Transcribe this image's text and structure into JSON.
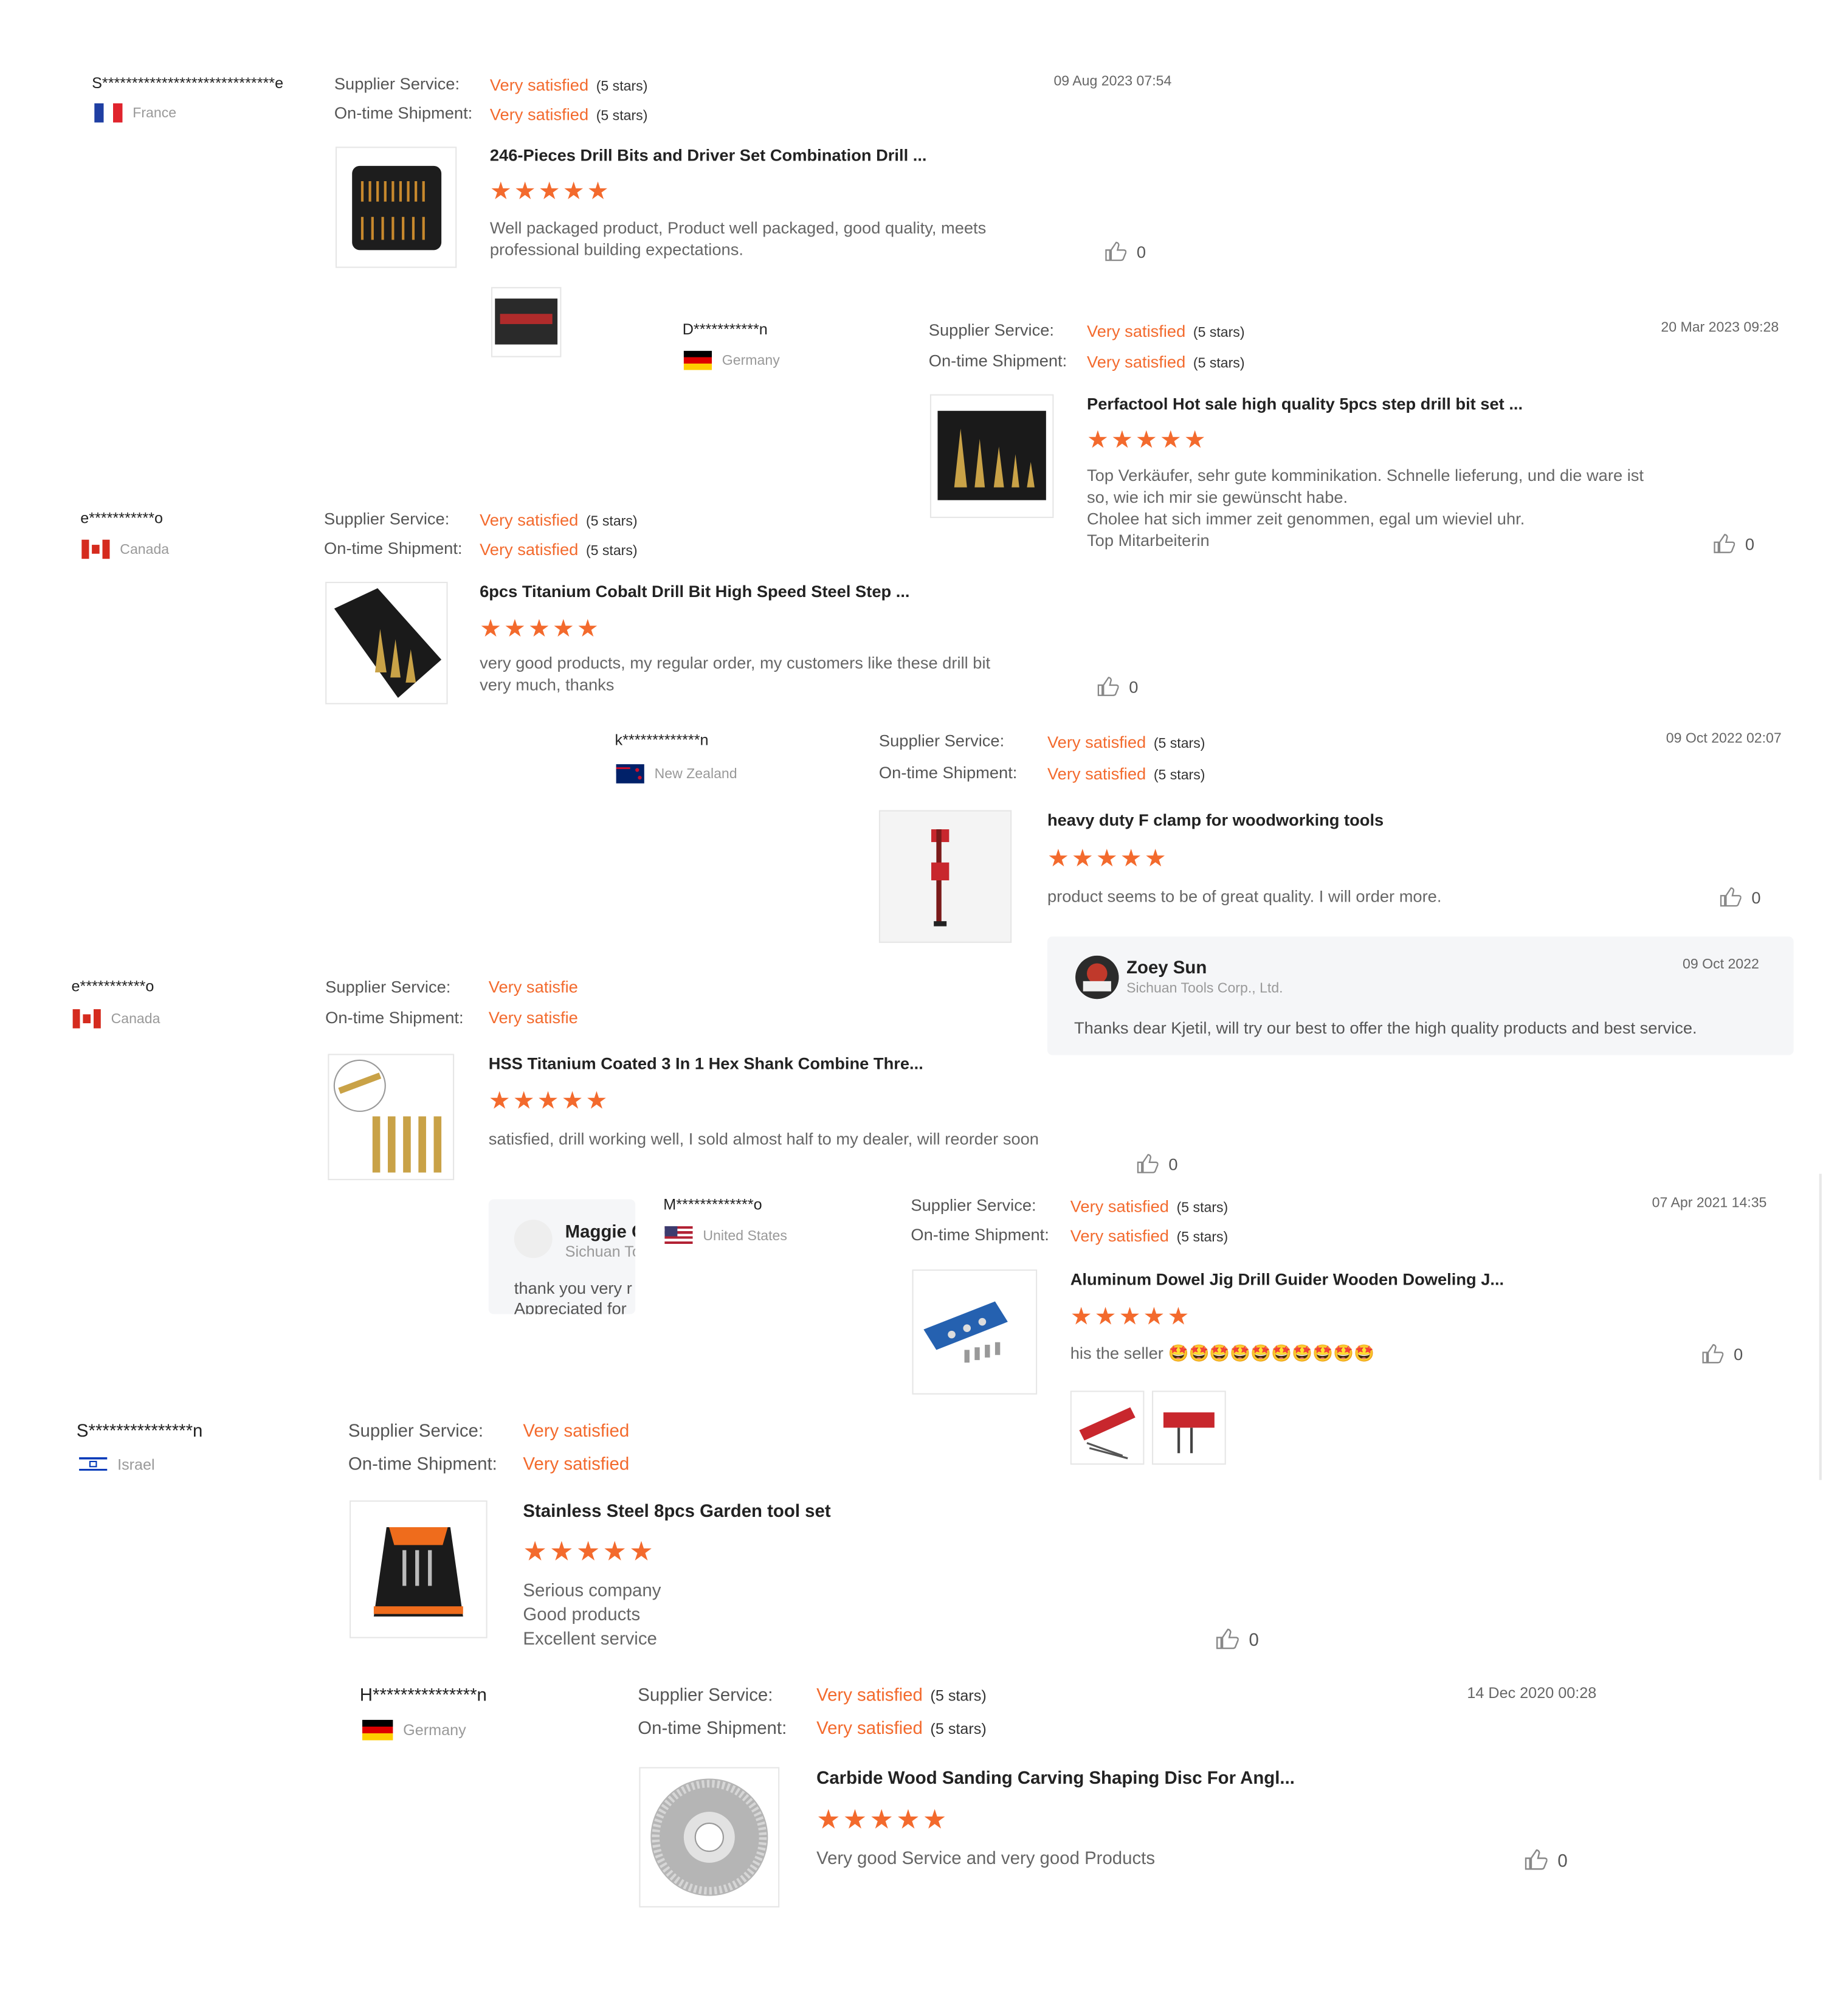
{
  "labels": {
    "supplier": "Supplier Service:",
    "shipment": "On-time Shipment:",
    "satisfied": "Very satisfied",
    "stars_note": "(5 stars)"
  },
  "reviews": [
    {
      "name": "S*****************************e",
      "country": "France",
      "date": "09 Aug 2023 07:54",
      "product": "246-Pieces Drill Bits and Driver Set Combination Drill ...",
      "comment": "Well packaged product, Product well packaged, good quality, meets professional building expectations.",
      "likes": "0"
    },
    {
      "name": "D***********n",
      "country": "Germany",
      "date": "20 Mar 2023 09:28",
      "product": "Perfactool Hot sale high quality 5pcs step drill bit set ...",
      "comment_lines": [
        "Top Verkäufer, sehr gute komminikation. Schnelle lieferung, und die ware ist so, wie ich mir sie gewünscht habe.",
        "Cholee hat sich immer zeit genommen, egal um wieviel uhr.",
        "Top Mitarbeiterin"
      ],
      "likes": "0"
    },
    {
      "name": "e***********o",
      "country": "Canada",
      "product": "6pcs Titanium Cobalt Drill Bit High Speed Steel Step ...",
      "comment": "very good products, my regular order, my customers like these drill bit very much, thanks",
      "likes": "0"
    },
    {
      "name": "k*************n",
      "country": "New Zealand",
      "date": "09 Oct 2022 02:07",
      "product": "heavy duty F clamp for woodworking tools",
      "comment": "product seems to be of great quality. I will order more.",
      "likes": "0",
      "reply": {
        "author": "Zoey Sun",
        "company": "Sichuan Tools Corp., Ltd.",
        "date": "09 Oct 2022",
        "text": "Thanks dear Kjetil, will try our best to  offer the high quality products and best service."
      }
    },
    {
      "name": "e***********o",
      "country": "Canada",
      "product": "HSS Titanium Coated 3 In 1 Hex Shank Combine Thre...",
      "comment": "satisfied, drill working well, I sold almost half to my dealer, will reorder soon",
      "likes": "0",
      "satisfied_partial": "Very satisfie",
      "reply": {
        "author": "Maggie G",
        "company": "Sichuan To",
        "text1": "thank you very r",
        "text2": "Appreciated for"
      }
    },
    {
      "name": "M*************o",
      "country": "United States",
      "date": "07 Apr 2021 14:35",
      "product": "Aluminum Dowel Jig Drill Guider Wooden Doweling J...",
      "comment": "his the seller",
      "emoji": "🤩🤩🤩🤩🤩🤩🤩🤩🤩🤩",
      "likes": "0"
    },
    {
      "name": "S***************n",
      "country": "Israel",
      "product": "Stainless Steel 8pcs Garden tool set",
      "comment_lines": [
        "Serious company",
        "Good products",
        "Excellent service"
      ],
      "likes": "0"
    },
    {
      "name": "H***************n",
      "country": "Germany",
      "date": "14 Dec 2020 00:28",
      "product": "Carbide Wood Sanding Carving Shaping Disc For Angl...",
      "comment": "Very good Service and very good Products",
      "likes": "0"
    }
  ],
  "stars_glyph": "★★★★★",
  "colors": {
    "accent": "#f36a2d",
    "reply_bg": "#f5f6f8"
  },
  "icons": [
    "thumbs-up-icon",
    "flag-icon",
    "product-thumbnail"
  ]
}
